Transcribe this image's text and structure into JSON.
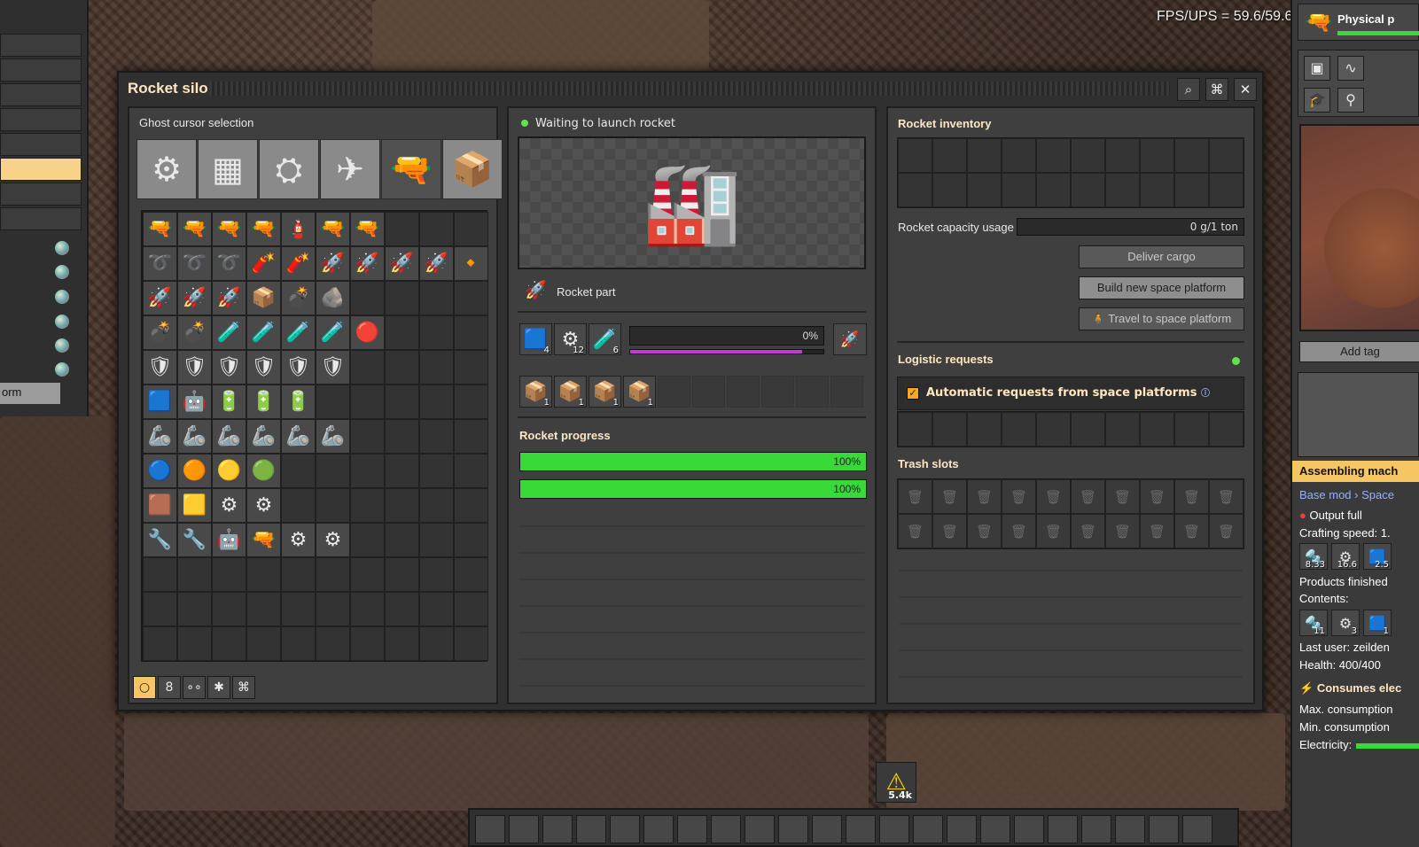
{
  "hud": {
    "fps": "FPS/UPS = 59.6/59.6"
  },
  "left_panel": {
    "tag_text": "orm"
  },
  "window": {
    "title": "Rocket silo",
    "buttons": [
      "search-icon",
      "network-icon",
      "close-icon"
    ]
  },
  "ghost": {
    "title": "Ghost cursor selection",
    "categories": [
      "⚙",
      "▦",
      "⛭",
      "✈",
      "🔫",
      "📦"
    ],
    "rows": [
      [
        "🔫",
        "🔫",
        "🔫",
        "🔫",
        "🧯",
        "🔫",
        "🔫",
        "",
        "",
        ""
      ],
      [
        "➰",
        "➰",
        "➰",
        "🧨",
        "🧨",
        "🚀",
        "🚀",
        "🚀",
        "🚀",
        "🔸"
      ],
      [
        "🚀",
        "🚀",
        "🚀",
        "📦",
        "💣",
        "🪨",
        "",
        "",
        "",
        ""
      ],
      [
        "💣",
        "💣",
        "🧪",
        "🧪",
        "🧪",
        "🧪",
        "🔴",
        "",
        "",
        ""
      ],
      [
        "🛡",
        "🛡",
        "🛡",
        "🛡",
        "🛡",
        "🛡",
        "",
        "",
        "",
        ""
      ],
      [
        "🟦",
        "🤖",
        "🔋",
        "🔋",
        "🔋",
        "",
        "",
        "",
        "",
        ""
      ],
      [
        "🦾",
        "🦾",
        "🦾",
        "🦾",
        "🦾",
        "🦾",
        "",
        "",
        "",
        ""
      ],
      [
        "🔵",
        "🟠",
        "🟡",
        "🟢",
        "",
        "",
        "",
        "",
        "",
        ""
      ],
      [
        "🟫",
        "🟨",
        "⚙",
        "⚙",
        "",
        "",
        "",
        "",
        "",
        ""
      ],
      [
        "🔧",
        "🔧",
        "🤖",
        "🔫",
        "⚙",
        "⚙",
        "",
        "",
        "",
        ""
      ],
      [
        "",
        "",
        "",
        "",
        "",
        "",
        "",
        "",
        "",
        ""
      ],
      [
        "",
        "",
        "",
        "",
        "",
        "",
        "",
        "",
        "",
        ""
      ],
      [
        "",
        "",
        "",
        "",
        "",
        "",
        "",
        "",
        "",
        ""
      ]
    ],
    "filters": [
      "○",
      "8",
      "∘∘",
      "✱",
      "⌘"
    ]
  },
  "silo": {
    "status": "Waiting to launch rocket",
    "recipe_label": "Rocket part",
    "ingredients": [
      {
        "icon": "🟦",
        "count": "4"
      },
      {
        "icon": "⚙",
        "count": "12"
      },
      {
        "icon": "🧪",
        "count": "6"
      }
    ],
    "progress_percent": "0%",
    "crafting_progress": 0.0,
    "power_level": 0.89,
    "output_icon": "🚀",
    "modules": [
      {
        "icon": "📦",
        "count": "1"
      },
      {
        "icon": "📦",
        "count": "1"
      },
      {
        "icon": "📦",
        "count": "1"
      },
      {
        "icon": "📦",
        "count": "1"
      }
    ],
    "rocket_progress_title": "Rocket progress",
    "bars": [
      {
        "text": "100%",
        "value": 1.0
      },
      {
        "text": "100%",
        "value": 1.0
      }
    ]
  },
  "inventory": {
    "title": "Rocket inventory",
    "capacity_label": "Rocket capacity usage",
    "capacity_value": "0 g/1 ton",
    "deliver_label": "Deliver cargo",
    "build_label": "Build new space platform",
    "travel_label": "Travel to space platform",
    "logistic_title": "Logistic requests",
    "auto_requests_label": "Automatic requests from space platforms",
    "trash_title": "Trash slots"
  },
  "side": {
    "header": "Physical p",
    "add_tag": "Add tag",
    "entity_name": "Assembling mach",
    "breadcrumb": "Base mod › Space",
    "status": "Output full",
    "crafting_speed": "Crafting speed: 1.",
    "outputs": [
      {
        "icon": "🔩",
        "count": "8.33"
      },
      {
        "icon": "⚙",
        "count": "16.6"
      },
      {
        "icon": "🟦",
        "count": "2.5"
      }
    ],
    "products_finished": "Products finished",
    "contents_label": "Contents:",
    "contents": [
      {
        "icon": "🔩",
        "count": "11"
      },
      {
        "icon": "⚙",
        "count": "3"
      },
      {
        "icon": "🟦",
        "count": "1"
      }
    ],
    "last_user": "Last user: zeilden",
    "health": "Health: 400/400",
    "consumes": "Consumes elec",
    "max_consumption": "Max. consumption",
    "min_consumption": "Min. consumption",
    "electricity": "Electricity:"
  },
  "alert": {
    "icon": "⚠",
    "count": "5.4k"
  },
  "colors": {
    "progress_green": "#3ad93a",
    "status_green": "#64e14c",
    "power_purple": "#c23bd1",
    "title_text": "#ffe6c0"
  }
}
